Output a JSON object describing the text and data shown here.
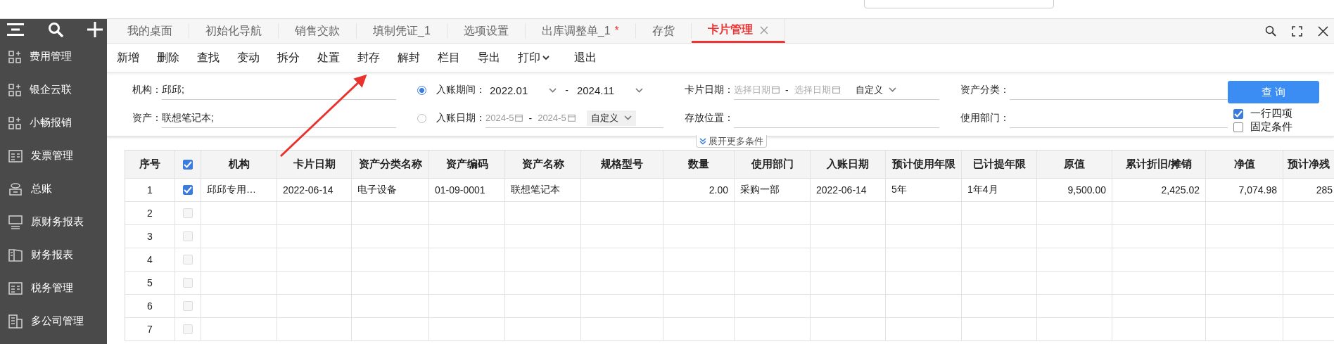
{
  "sidebar": {
    "items": [
      {
        "label": "费用管理"
      },
      {
        "label": "银企云联"
      },
      {
        "label": "小畅报销"
      },
      {
        "label": "发票管理"
      },
      {
        "label": "总账"
      },
      {
        "label": "原财务报表"
      },
      {
        "label": "财务报表"
      },
      {
        "label": "税务管理"
      },
      {
        "label": "多公司管理"
      }
    ]
  },
  "tabs": [
    {
      "label": "我的桌面",
      "selected": false
    },
    {
      "label": "初始化导航",
      "selected": false
    },
    {
      "label": "销售交款",
      "selected": false
    },
    {
      "label": "填制凭证_1",
      "selected": false
    },
    {
      "label": "选项设置",
      "selected": false
    },
    {
      "label": "出库调整单_1",
      "selected": false,
      "marker": "*"
    },
    {
      "label": "存货",
      "selected": false
    },
    {
      "label": "卡片管理",
      "selected": true
    }
  ],
  "toolbar": [
    {
      "label": "新增",
      "dropdown": false
    },
    {
      "label": "删除",
      "dropdown": false
    },
    {
      "label": "查找",
      "dropdown": false
    },
    {
      "label": "变动",
      "dropdown": false
    },
    {
      "label": "拆分",
      "dropdown": false
    },
    {
      "label": "处置",
      "dropdown": false
    },
    {
      "label": "封存",
      "dropdown": false
    },
    {
      "label": "解封",
      "dropdown": false
    },
    {
      "label": "栏目",
      "dropdown": false
    },
    {
      "label": "导出",
      "dropdown": false
    },
    {
      "label": "打印",
      "dropdown": true
    },
    {
      "label": "退出",
      "dropdown": false
    }
  ],
  "filters": {
    "org": {
      "label": "机构：",
      "value": "邱邱;"
    },
    "asset": {
      "label": "资产：",
      "value": "联想笔记本;"
    },
    "period": {
      "label": "入账期间：",
      "selected": true,
      "from": "2022.01",
      "separator": "-",
      "to": "2024.11"
    },
    "post_date": {
      "label": "入账日期：",
      "selected": false,
      "from": "2024-5",
      "separator": "-",
      "to": "2024-5",
      "mode": "自定义"
    },
    "card_date": {
      "label": "卡片日期：",
      "from_placeholder": "选择日期",
      "separator": "-",
      "to_placeholder": "选择日期",
      "mode": "自定义"
    },
    "storage": {
      "label": "存放位置："
    },
    "category": {
      "label": "资产分类："
    },
    "dept": {
      "label": "使用部门："
    },
    "query_button": "查 询",
    "options": [
      {
        "label": "一行四项",
        "checked": true
      },
      {
        "label": "固定条件",
        "checked": false
      }
    ],
    "expand": "展开更多条件"
  },
  "table": {
    "header_checked": true,
    "number_column": "序号",
    "columns": [
      "机构",
      "卡片日期",
      "资产分类名称",
      "资产编码",
      "资产名称",
      "规格型号",
      "数量",
      "使用部门",
      "入账日期",
      "预计使用年限",
      "已计提年限",
      "原值",
      "累计折旧/摊销",
      "净值",
      "预计净残"
    ],
    "rows": [
      {
        "no": "1",
        "checked": true,
        "cells": [
          "邱邱专用…",
          "2022-06-14",
          "电子设备",
          "01-09-0001",
          "联想笔记本",
          null,
          "2.00",
          "采购一部",
          "2022-06-14",
          "5年",
          "1年4月",
          "9,500.00",
          "2,425.02",
          "7,074.98",
          "285"
        ]
      },
      {
        "no": "2",
        "checked": false
      },
      {
        "no": "3",
        "checked": false
      },
      {
        "no": "4",
        "checked": false
      },
      {
        "no": "5",
        "checked": false
      },
      {
        "no": "6",
        "checked": false
      },
      {
        "no": "7",
        "checked": false
      }
    ]
  }
}
